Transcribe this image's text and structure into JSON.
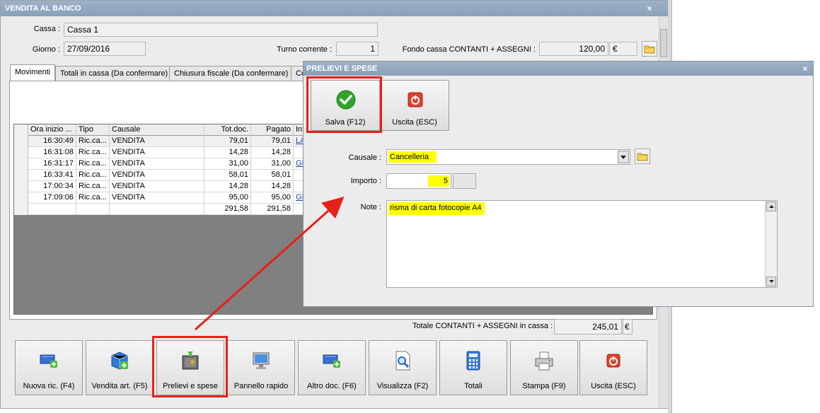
{
  "main": {
    "title": "VENDITA AL BANCO",
    "close": "×",
    "cassa_label": "Cassa :",
    "cassa_value": "Cassa 1",
    "giorno_label": "Giorno :",
    "giorno_value": "27/09/2016",
    "turno_label": "Turno corrente :",
    "turno_value": "1",
    "fondo_label": "Fondo cassa CONTANTI + ASSEGNI :",
    "fondo_value": "120,00",
    "currency": "€",
    "tabs": [
      {
        "label": "Movimenti"
      },
      {
        "label": "Totali in cassa (Da confermare)"
      },
      {
        "label": "Chiusura fiscale (Da confermare)"
      },
      {
        "label": "Co"
      }
    ],
    "grid": {
      "headers": [
        "Ora inizio ...",
        "Tipo",
        "Causale",
        "Tot.doc.",
        "Pagato",
        "Int"
      ],
      "rows": [
        {
          "ora": "16:30:49",
          "tipo": "Ric.ca...",
          "causale": "VENDITA",
          "tot": "79,01",
          "pagato": "79,01",
          "int": "LA"
        },
        {
          "ora": "16:31:08",
          "tipo": "Ric.ca...",
          "causale": "VENDITA",
          "tot": "14,28",
          "pagato": "14,28",
          "int": ""
        },
        {
          "ora": "16:31:17",
          "tipo": "Ric.ca...",
          "causale": "VENDITA",
          "tot": "31,00",
          "pagato": "31,00",
          "int": "GI"
        },
        {
          "ora": "16:33:41",
          "tipo": "Ric.ca...",
          "causale": "VENDITA",
          "tot": "58,01",
          "pagato": "58,01",
          "int": ""
        },
        {
          "ora": "17:00:34",
          "tipo": "Ric.ca...",
          "causale": "VENDITA",
          "tot": "14,28",
          "pagato": "14,28",
          "int": ""
        },
        {
          "ora": "17:09:06",
          "tipo": "Ric.ca...",
          "causale": "VENDITA",
          "tot": "95,00",
          "pagato": "95,00",
          "int": "GI"
        }
      ],
      "totals": {
        "tot": "291,58",
        "pagato": "291,58"
      }
    },
    "totale_label": "Totale CONTANTI + ASSEGNI in cassa :",
    "totale_value": "245,01",
    "buttons": [
      {
        "label": "Nuova ric. (F4)"
      },
      {
        "label": "Vendita art. (F5)"
      },
      {
        "label": "Prelievi e spese"
      },
      {
        "label": "Pannello rapido"
      },
      {
        "label": "Altro doc. (F6)"
      },
      {
        "label": "Visualizza (F2)"
      },
      {
        "label": "Totali"
      },
      {
        "label": "Stampa (F9)"
      },
      {
        "label": "Uscita (ESC)"
      }
    ]
  },
  "dialog": {
    "title": "PRELIEVI E SPESE",
    "close": "×",
    "save_label": "Salva (F12)",
    "exit_label": "Uscita (ESC)",
    "causale_label": "Causale :",
    "causale_value": "Cancelleria",
    "importo_label": "Importo :",
    "importo_value": "5",
    "note_label": "Note :",
    "note_value": "risma di carta fotocopie A4"
  },
  "colors": {
    "highlight": "#ffff00",
    "annotation_red": "#e8201a",
    "title_bar": "#8aa0ba"
  }
}
